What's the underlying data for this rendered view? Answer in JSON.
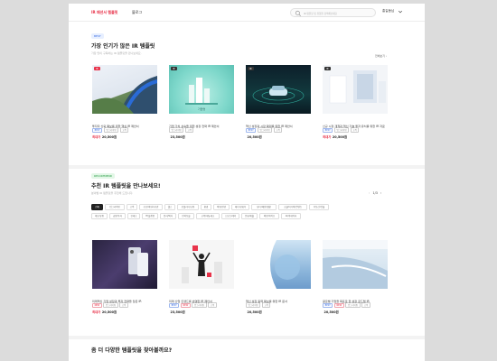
{
  "header": {
    "logo": "IR 패션서 템플릿",
    "nav_blog": "블로그",
    "search_placeholder": "IR 템플릿 및 유형을 검색해보세요",
    "user_menu": "홍길동님"
  },
  "best": {
    "badge": "BEST",
    "title": "가장 인기가 많은 IR 템플릿",
    "subtitle": "가장 많이 구독하는 IR 템플릿을 만나보세요.",
    "more": "전체보기",
    "cards": [
      {
        "tag": "IR",
        "tags": [
          "BEST",
          "업그리이핑",
          "고객"
        ],
        "title": "투자자 신뢰 확보를 위한 핵심 IR 제안서",
        "discount": "최대가",
        "price": "20,500원"
      },
      {
        "tag": "IR",
        "tags": [
          "업그리이핑",
          "고객"
        ],
        "title": "기업 가치 상승을 위한 성장 전략 IR 제안서",
        "discount": "",
        "price": "23,500원"
      },
      {
        "tag": "IR",
        "tags": [
          "BEST",
          "업그리이핑",
          "고객"
        ],
        "title": "혁신 성장과 시장 확대를 위한 IR 제안서",
        "discount": "",
        "price": "20,500원"
      },
      {
        "tag": "IR",
        "tags": [
          "BEST",
          "업그리이핑",
          "고객"
        ],
        "title": "신규 시장 개척과 혁신 기술 투자 유치를 위한 IR 자료",
        "discount": "최대가",
        "price": "20,500원"
      }
    ]
  },
  "recommend": {
    "badge": "RECOMMEND",
    "title": "추천 IR 템플릿을 만나보세요!",
    "subtitle": "분야별 IR 템플릿을 추천해 드립니다.",
    "pager": "1/3",
    "chips": [
      "전체",
      "업그리이핑",
      "고객",
      "공공/비영리기관",
      "헬스",
      "모빌리티/교통",
      "환경",
      "여행/관광",
      "에너지/화학",
      "뷰티/패션/생활",
      "소셜/미디어/컨텐츠",
      "부동산/건설",
      "제조/유통",
      "금융/투자",
      "핀테크",
      "IT/플랫폼",
      "음식/외식",
      "반려동물",
      "교육/에듀테크",
      "스포츠/레저",
      "문화/예술",
      "의료/바이오",
      "AI/빅데이터"
    ],
    "cards": [
      {
        "tags": [
          "NEW",
          "업그리이핑",
          "고객"
        ],
        "title": "미래혁신 기업 성장과 투자 전략을 담은 IR",
        "discount": "최대가",
        "price": "20,500원"
      },
      {
        "tags": [
          "BEST",
          "NEW",
          "업그리이핑",
          "고객"
        ],
        "title": "미래 산업 트렌드를 반영한 IR 제안서",
        "discount": "",
        "price": "23,500원"
      },
      {
        "tags": [
          "업그리이핑",
          "고객"
        ],
        "title": "혁신 성장 동력 확보를 위한 IR 문서",
        "discount": "",
        "price": "20,500원"
      },
      {
        "tags": [
          "BEST",
          "NEW",
          "업그리이핑",
          "고객"
        ],
        "title": "글로벌 기업을 목표로 한 성장 로드맵 IR",
        "discount": "",
        "price": "20,500원"
      }
    ]
  },
  "more_section": {
    "title": "좀 더 다양한 템플릿을 찾아볼까요?"
  }
}
